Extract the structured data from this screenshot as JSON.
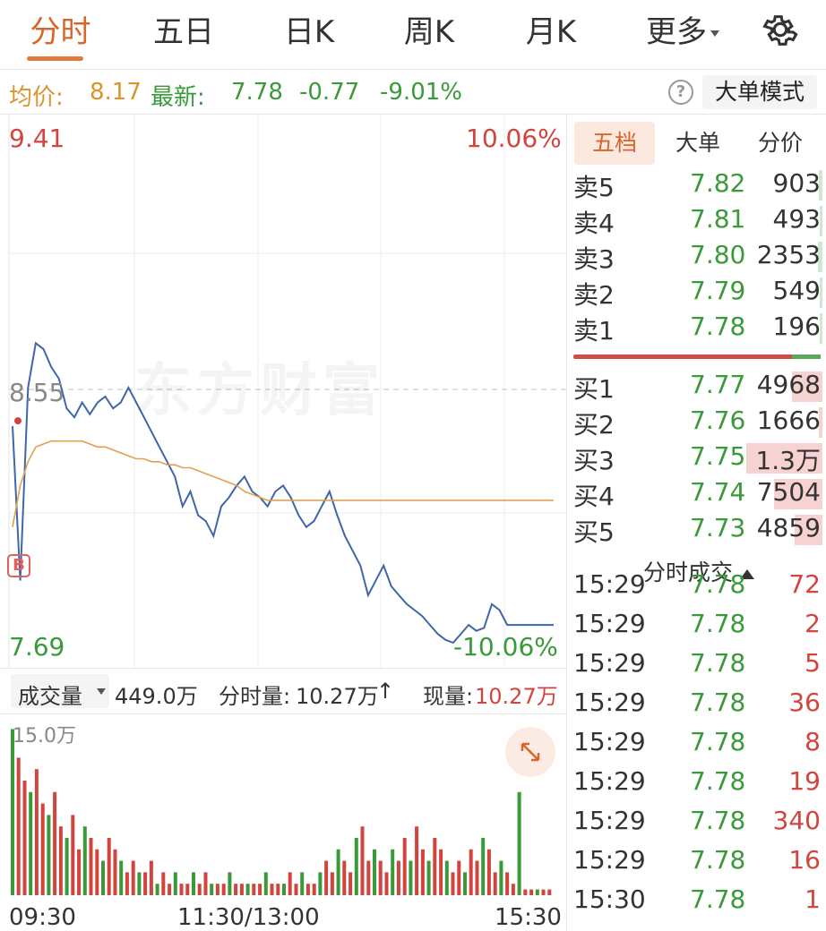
{
  "tabs": [
    {
      "label": "分时",
      "active": true
    },
    {
      "label": "五日"
    },
    {
      "label": "日K"
    },
    {
      "label": "周K"
    },
    {
      "label": "月K"
    },
    {
      "label": "更多"
    }
  ],
  "info": {
    "avg_label": "均价:",
    "avg_value": "8.17",
    "latest_label": "最新:",
    "latest_value": "7.78",
    "change": "-0.77",
    "change_pct": "-9.01%",
    "mode_button": "大单模式"
  },
  "chart": {
    "price_high": "9.41",
    "price_low": "7.69",
    "price_mid": "8.55",
    "pct_high": "10.06%",
    "pct_low": "-10.06%",
    "watermark": "东方财富",
    "buy_marker": "B",
    "colors": {
      "price_line": "#3f66a8",
      "avg_line": "#e0a050",
      "up": "#d2453e",
      "down": "#3a9a3a"
    }
  },
  "chart_data": {
    "type": "line",
    "series": [
      {
        "name": "price",
        "values": [
          8.42,
          7.9,
          8.55,
          8.7,
          8.68,
          8.62,
          8.58,
          8.48,
          8.45,
          8.5,
          8.46,
          8.5,
          8.52,
          8.48,
          8.5,
          8.55,
          8.5,
          8.45,
          8.4,
          8.35,
          8.3,
          8.25,
          8.15,
          8.2,
          8.12,
          8.1,
          8.05,
          8.15,
          8.18,
          8.22,
          8.25,
          8.2,
          8.18,
          8.15,
          8.2,
          8.22,
          8.18,
          8.12,
          8.08,
          8.1,
          8.15,
          8.2,
          8.12,
          8.05,
          8.0,
          7.95,
          7.85,
          7.9,
          7.95,
          7.88,
          7.85,
          7.82,
          7.8,
          7.78,
          7.75,
          7.72,
          7.7,
          7.69,
          7.72,
          7.75,
          7.73,
          7.74,
          7.82,
          7.8,
          7.75,
          7.75,
          7.75,
          7.75,
          7.75,
          7.75,
          7.75
        ]
      },
      {
        "name": "avg",
        "values": [
          8.08,
          8.22,
          8.3,
          8.35,
          8.36,
          8.37,
          8.37,
          8.37,
          8.37,
          8.37,
          8.36,
          8.35,
          8.35,
          8.34,
          8.33,
          8.32,
          8.31,
          8.31,
          8.3,
          8.3,
          8.29,
          8.29,
          8.28,
          8.28,
          8.27,
          8.26,
          8.25,
          8.24,
          8.23,
          8.22,
          8.2,
          8.19,
          8.18,
          8.17,
          8.17,
          8.17,
          8.17,
          8.17,
          8.17,
          8.17,
          8.17,
          8.17,
          8.17,
          8.17,
          8.17,
          8.17,
          8.17,
          8.17,
          8.17,
          8.17,
          8.17,
          8.17,
          8.17,
          8.17,
          8.17,
          8.17,
          8.17,
          8.17,
          8.17,
          8.17,
          8.17,
          8.17,
          8.17,
          8.17,
          8.17,
          8.17,
          8.17,
          8.17,
          8.17,
          8.17,
          8.17
        ]
      }
    ],
    "ylim": [
      7.69,
      9.41
    ],
    "volume": [
      14.5,
      12,
      10,
      9,
      11,
      8,
      7,
      9,
      6,
      5,
      7,
      4,
      6,
      5,
      4,
      3,
      5,
      4,
      3,
      2,
      3,
      2,
      2,
      3,
      1,
      2,
      1,
      2,
      1,
      1,
      2,
      1,
      2,
      1,
      1,
      1,
      2,
      1,
      1,
      1,
      1,
      1,
      2,
      1,
      1,
      1,
      2,
      1,
      2,
      1,
      1,
      2,
      3,
      2,
      4,
      3,
      2,
      5,
      6,
      3,
      4,
      3,
      2,
      4,
      3,
      5,
      3,
      6,
      4,
      3,
      5,
      4,
      3,
      2,
      3,
      2,
      4,
      3,
      5,
      4,
      2,
      3,
      2,
      1,
      9,
      0.5,
      0.5,
      0.5,
      0.5,
      0.5
    ],
    "volume_max_label": "15.0万",
    "x_ticks": [
      "09:30",
      "11:30/13:00",
      "15:30"
    ]
  },
  "volume_bar": {
    "selector": "成交量",
    "total": "449.0万",
    "fs_label": "分时量:",
    "fs_value": "10.27万",
    "now_label": "现量:",
    "now_value": "10.27万"
  },
  "panel": {
    "tabs": [
      "五档",
      "大单",
      "分价"
    ],
    "sells": [
      {
        "label": "卖5",
        "price": "7.82",
        "vol": "903",
        "bar": 0.04
      },
      {
        "label": "卖4",
        "price": "7.81",
        "vol": "493",
        "bar": 0.02
      },
      {
        "label": "卖3",
        "price": "7.80",
        "vol": "2353",
        "bar": 0.06
      },
      {
        "label": "卖2",
        "price": "7.79",
        "vol": "549",
        "bar": 0.02
      },
      {
        "label": "卖1",
        "price": "7.78",
        "vol": "196",
        "bar": 0.01
      }
    ],
    "buys": [
      {
        "label": "买1",
        "price": "7.77",
        "vol": "4968",
        "bar": 0.38
      },
      {
        "label": "买2",
        "price": "7.76",
        "vol": "1666",
        "bar": 0.05
      },
      {
        "label": "买3",
        "price": "7.75",
        "vol": "1.3万",
        "bar": 0.95
      },
      {
        "label": "买4",
        "price": "7.74",
        "vol": "7504",
        "bar": 0.6
      },
      {
        "label": "买5",
        "price": "7.73",
        "vol": "4859",
        "bar": 0.34
      }
    ],
    "trades_title": "分时成交",
    "trades": [
      {
        "time": "15:29",
        "price": "7.78",
        "vol": "72"
      },
      {
        "time": "15:29",
        "price": "7.78",
        "vol": "2"
      },
      {
        "time": "15:29",
        "price": "7.78",
        "vol": "5"
      },
      {
        "time": "15:29",
        "price": "7.78",
        "vol": "36"
      },
      {
        "time": "15:29",
        "price": "7.78",
        "vol": "8"
      },
      {
        "time": "15:29",
        "price": "7.78",
        "vol": "19"
      },
      {
        "time": "15:29",
        "price": "7.78",
        "vol": "340"
      },
      {
        "time": "15:29",
        "price": "7.78",
        "vol": "16"
      },
      {
        "time": "15:30",
        "price": "7.78",
        "vol": "1"
      }
    ]
  }
}
